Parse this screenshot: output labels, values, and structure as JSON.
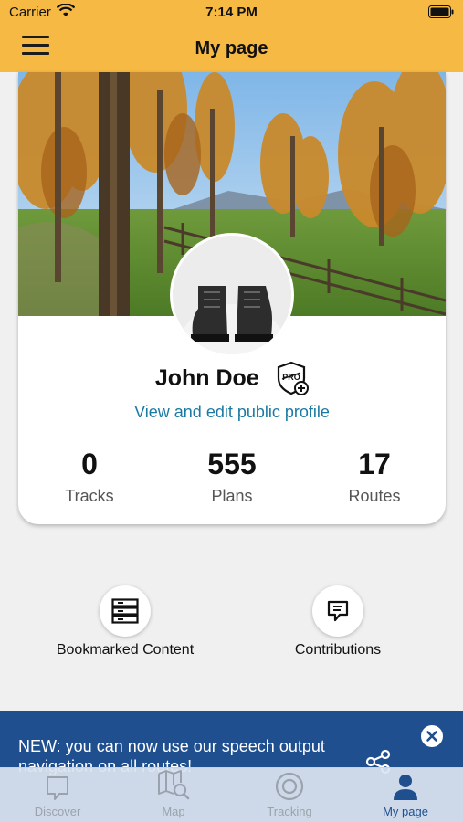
{
  "status_bar": {
    "carrier": "Carrier",
    "time": "7:14 PM"
  },
  "header": {
    "title": "My page"
  },
  "profile": {
    "name": "John Doe",
    "badge": "PRO",
    "edit_link": "View and edit public profile",
    "stats": [
      {
        "value": "0",
        "label": "Tracks"
      },
      {
        "value": "555",
        "label": "Plans"
      },
      {
        "value": "17",
        "label": "Routes"
      }
    ]
  },
  "shortcuts": [
    {
      "label": "Bookmarked Content",
      "icon": "bookmark-list-icon"
    },
    {
      "label": "Contributions",
      "icon": "speech-bubble-icon"
    }
  ],
  "banner": {
    "text": "NEW: you can now use our speech output navigation on all routes!"
  },
  "tabs": [
    {
      "label": "Discover",
      "icon": "discover-icon",
      "active": false
    },
    {
      "label": "Map",
      "icon": "map-search-icon",
      "active": false
    },
    {
      "label": "Tracking",
      "icon": "tracking-icon",
      "active": false
    },
    {
      "label": "My page",
      "icon": "person-icon",
      "active": true
    }
  ],
  "colors": {
    "header_bg": "#f5b944",
    "link": "#1a7aa3",
    "banner_bg": "#1f4f8f",
    "tab_active": "#1f4f8f",
    "tab_inactive": "#9aa3ad"
  }
}
